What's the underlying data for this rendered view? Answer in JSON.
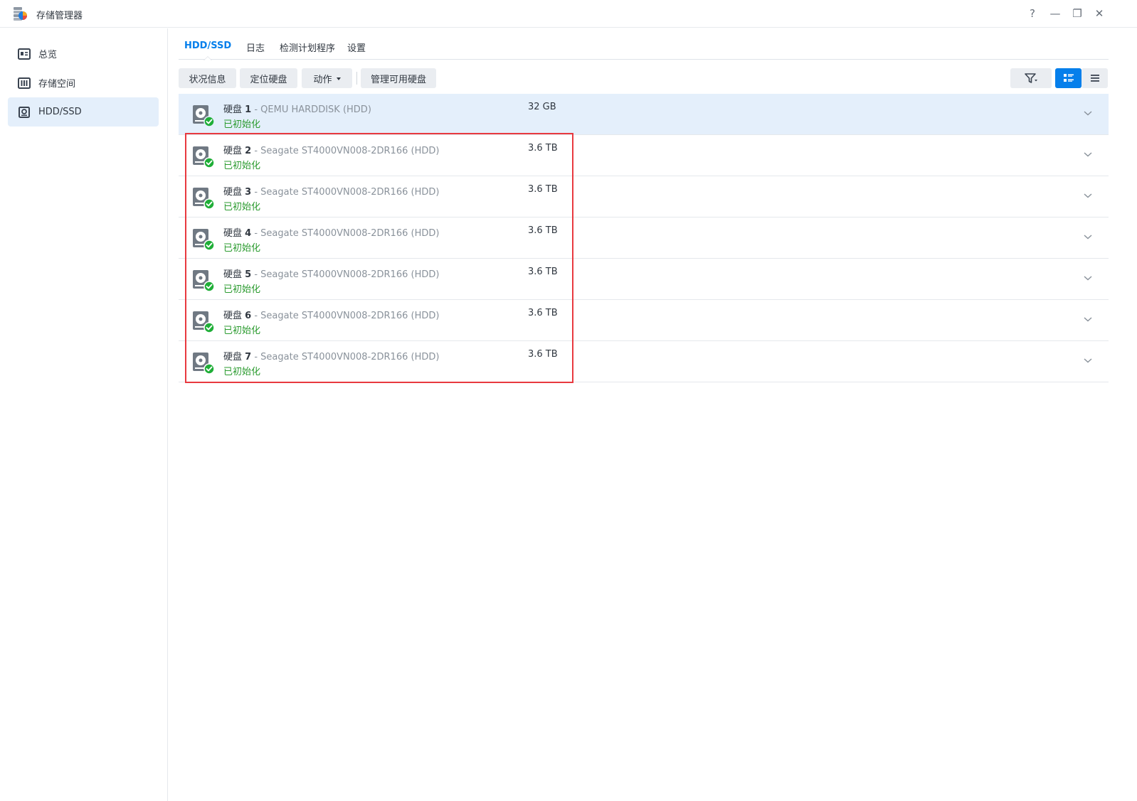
{
  "window": {
    "title": "存储管理器",
    "controls": [
      "?",
      "—",
      "❐",
      "✕"
    ]
  },
  "sidebar": {
    "items": [
      {
        "label": "总览",
        "icon": "overview-icon",
        "active": false
      },
      {
        "label": "存储空间",
        "icon": "storage-pool-icon",
        "active": false
      },
      {
        "label": "HDD/SSD",
        "icon": "hdd-icon",
        "active": true
      }
    ]
  },
  "tabs": [
    {
      "label": "HDD/SSD",
      "active": true
    },
    {
      "label": "日志",
      "active": false
    },
    {
      "label": "检测计划程序",
      "active": false
    },
    {
      "label": "设置",
      "active": false
    }
  ],
  "toolbar": {
    "status_info": "状况信息",
    "locate_disk": "定位硬盘",
    "action": "动作",
    "manage_disks": "管理可用硬盘"
  },
  "disks": [
    {
      "name": "硬盘",
      "number": "1",
      "model": "QEMU HARDDISK (HDD)",
      "status": "已初始化",
      "size": "32 GB",
      "selected": true
    },
    {
      "name": "硬盘",
      "number": "2",
      "model": "Seagate ST4000VN008-2DR166 (HDD)",
      "status": "已初始化",
      "size": "3.6 TB",
      "selected": false
    },
    {
      "name": "硬盘",
      "number": "3",
      "model": "Seagate ST4000VN008-2DR166 (HDD)",
      "status": "已初始化",
      "size": "3.6 TB",
      "selected": false
    },
    {
      "name": "硬盘",
      "number": "4",
      "model": "Seagate ST4000VN008-2DR166 (HDD)",
      "status": "已初始化",
      "size": "3.6 TB",
      "selected": false
    },
    {
      "name": "硬盘",
      "number": "5",
      "model": "Seagate ST4000VN008-2DR166 (HDD)",
      "status": "已初始化",
      "size": "3.6 TB",
      "selected": false
    },
    {
      "name": "硬盘",
      "number": "6",
      "model": "Seagate ST4000VN008-2DR166 (HDD)",
      "status": "已初始化",
      "size": "3.6 TB",
      "selected": false
    },
    {
      "name": "硬盘",
      "number": "7",
      "model": "Seagate ST4000VN008-2DR166 (HDD)",
      "status": "已初始化",
      "size": "3.6 TB",
      "selected": false
    }
  ],
  "colors": {
    "accent": "#057feb",
    "status_ok": "#2b9b2f",
    "highlight": "#e8393f",
    "selected_row": "#e4effb"
  }
}
